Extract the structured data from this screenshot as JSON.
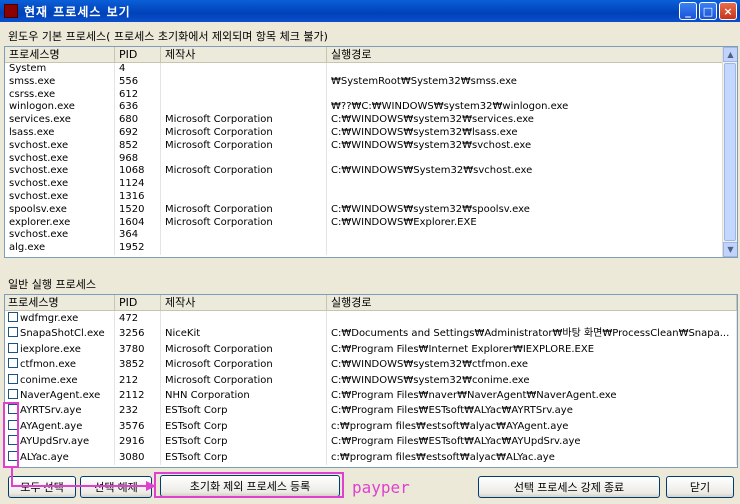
{
  "window": {
    "title": "현재 프로세스 보기",
    "min": "_",
    "max": "□",
    "close": "×"
  },
  "section1": {
    "label": "윈도우 기본 프로세스( 프로세스 초기화에서 제외되며 항목 체크 불가)",
    "columns": [
      "프로세스명",
      "PID",
      "제작사",
      "실행경로"
    ],
    "rows": [
      [
        "System",
        "4",
        "",
        ""
      ],
      [
        "smss.exe",
        "556",
        "",
        "₩SystemRoot₩System32₩smss.exe"
      ],
      [
        "csrss.exe",
        "612",
        "",
        ""
      ],
      [
        "winlogon.exe",
        "636",
        "",
        "₩??₩C:₩WINDOWS₩system32₩winlogon.exe"
      ],
      [
        "services.exe",
        "680",
        "Microsoft Corporation",
        "C:₩WINDOWS₩system32₩services.exe"
      ],
      [
        "lsass.exe",
        "692",
        "Microsoft Corporation",
        "C:₩WINDOWS₩system32₩lsass.exe"
      ],
      [
        "svchost.exe",
        "852",
        "Microsoft Corporation",
        "C:₩WINDOWS₩system32₩svchost.exe"
      ],
      [
        "svchost.exe",
        "968",
        "",
        ""
      ],
      [
        "svchost.exe",
        "1068",
        "Microsoft Corporation",
        "C:₩WINDOWS₩System32₩svchost.exe"
      ],
      [
        "svchost.exe",
        "1124",
        "",
        ""
      ],
      [
        "svchost.exe",
        "1316",
        "",
        ""
      ],
      [
        "spoolsv.exe",
        "1520",
        "Microsoft Corporation",
        "C:₩WINDOWS₩system32₩spoolsv.exe"
      ],
      [
        "explorer.exe",
        "1604",
        "Microsoft Corporation",
        "C:₩WINDOWS₩Explorer.EXE"
      ],
      [
        "svchost.exe",
        "364",
        "",
        ""
      ],
      [
        "alg.exe",
        "1952",
        "",
        ""
      ]
    ]
  },
  "section2": {
    "label": "일반 실행 프로세스",
    "columns": [
      "프로세스명",
      "PID",
      "제작사",
      "실행경로"
    ],
    "rows": [
      [
        "wdfmgr.exe",
        "472",
        "",
        ""
      ],
      [
        "SnapaShotCl.exe",
        "3256",
        "NiceKit",
        "C:₩Documents and Settings₩Administrator₩바탕 화면₩ProcessClean₩Snapa..."
      ],
      [
        "iexplore.exe",
        "3780",
        "Microsoft Corporation",
        "C:₩Program Files₩Internet Explorer₩IEXPLORE.EXE"
      ],
      [
        "ctfmon.exe",
        "3852",
        "Microsoft Corporation",
        "C:₩WINDOWS₩system32₩ctfmon.exe"
      ],
      [
        "conime.exe",
        "212",
        "Microsoft Corporation",
        "C:₩WINDOWS₩system32₩conime.exe"
      ],
      [
        "NaverAgent.exe",
        "2112",
        "NHN Corporation",
        "C:₩Program Files₩naver₩NaverAgent₩NaverAgent.exe"
      ],
      [
        "AYRTSrv.aye",
        "232",
        "ESTsoft Corp",
        "C:₩Program Files₩ESTsoft₩ALYac₩AYRTSrv.aye"
      ],
      [
        "AYAgent.aye",
        "3576",
        "ESTsoft Corp",
        "c:₩program files₩estsoft₩alyac₩AYAgent.aye"
      ],
      [
        "AYUpdSrv.aye",
        "2916",
        "ESTsoft Corp",
        "C:₩Program Files₩ESTsoft₩ALYac₩AYUpdSrv.aye"
      ],
      [
        "ALYac.aye",
        "3080",
        "ESTsoft Corp",
        "c:₩program files₩estsoft₩alyac₩ALYac.aye"
      ]
    ]
  },
  "buttons": {
    "select_all": "모두 선택",
    "deselect": "선택 해제",
    "register_exclude": "초기화 제외 프로세스 등록",
    "kill_selected": "선택 프로세스 강제 종료",
    "close": "닫기"
  },
  "annotation": {
    "text": "payper",
    "color": "#e040d0"
  }
}
